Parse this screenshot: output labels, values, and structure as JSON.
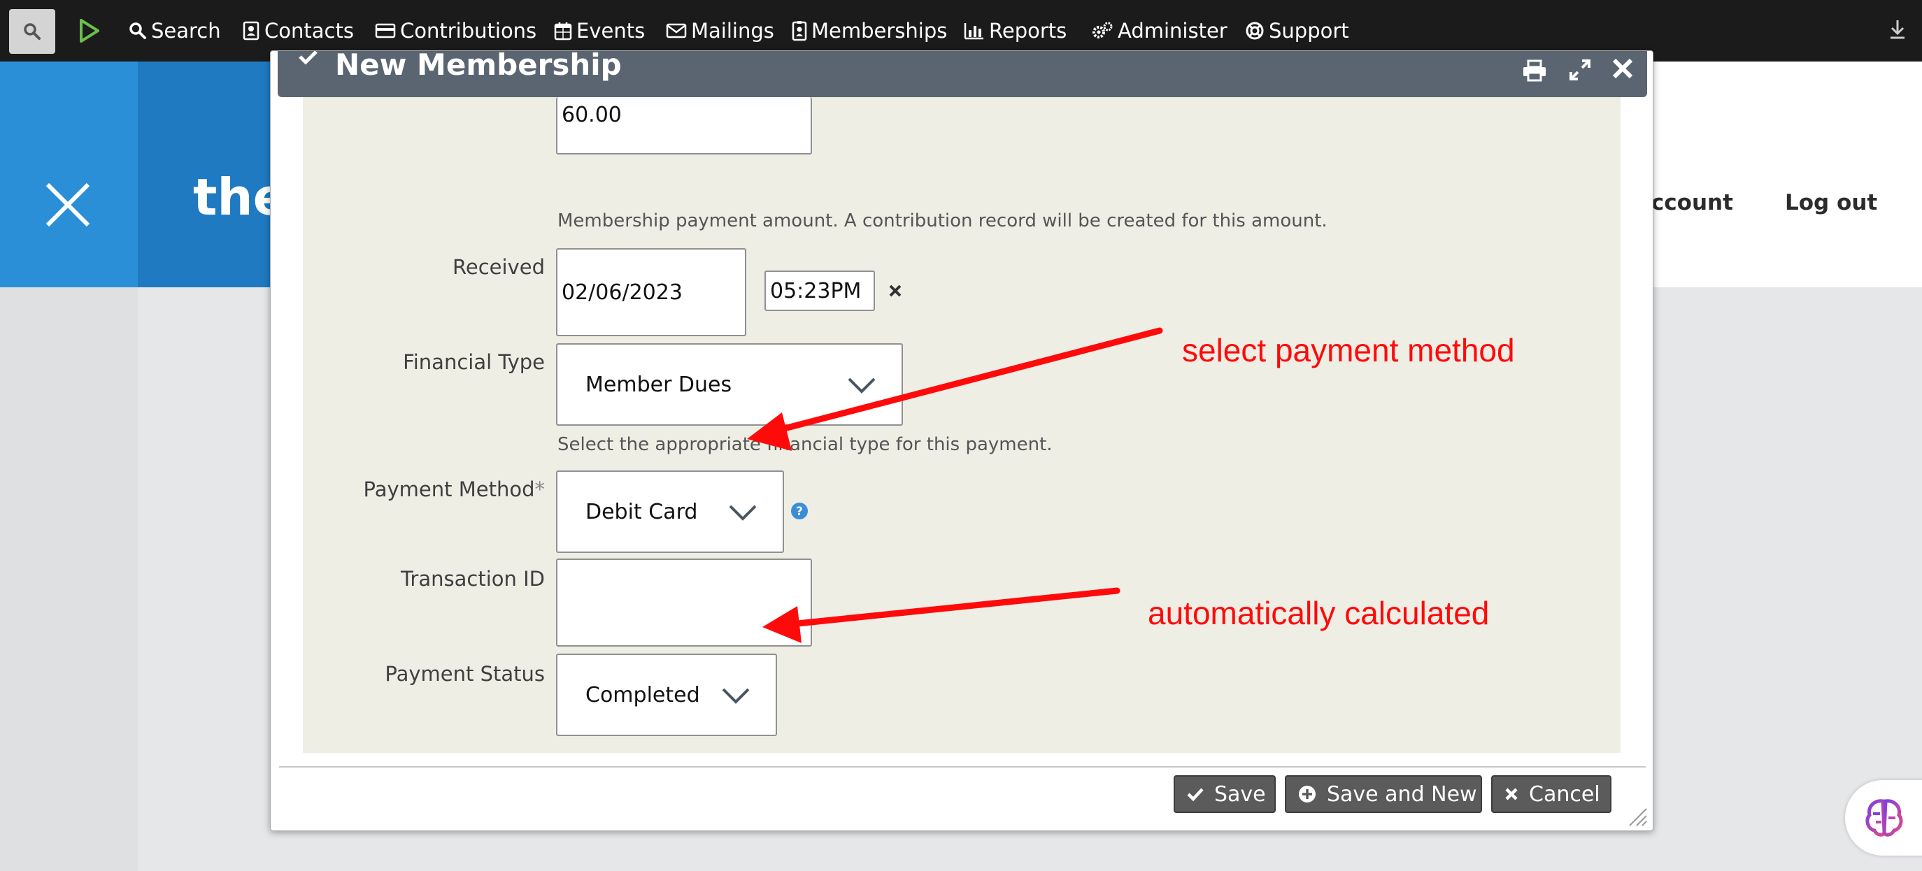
{
  "menubar": {
    "items": [
      {
        "label": "Search",
        "icon": "search-icon"
      },
      {
        "label": "Contacts",
        "icon": "contact-card-icon"
      },
      {
        "label": "Contributions",
        "icon": "credit-card-icon"
      },
      {
        "label": "Events",
        "icon": "calendar-icon"
      },
      {
        "label": "Mailings",
        "icon": "envelope-icon"
      },
      {
        "label": "Memberships",
        "icon": "id-badge-icon"
      },
      {
        "label": "Reports",
        "icon": "bar-chart-icon"
      },
      {
        "label": "Administer",
        "icon": "gears-icon"
      },
      {
        "label": "Support",
        "icon": "life-ring-icon"
      }
    ]
  },
  "site": {
    "title_fragment": "the",
    "account_link": "account",
    "logout_link": "Log out"
  },
  "dialog": {
    "title": "New Membership",
    "amount": {
      "value": "60.00",
      "help": "Membership payment amount. A contribution record will be created for this amount."
    },
    "received": {
      "label": "Received",
      "date": "02/06/2023",
      "time": "05:23PM"
    },
    "financial_type": {
      "label": "Financial Type",
      "value": "Member Dues",
      "help": "Select the appropriate financial type for this payment."
    },
    "payment_method": {
      "label": "Payment Method",
      "required_mark": "*",
      "value": "Debit Card"
    },
    "transaction_id": {
      "label": "Transaction ID",
      "value": ""
    },
    "payment_status": {
      "label": "Payment Status",
      "value": "Completed"
    },
    "buttons": {
      "save": "Save",
      "save_new": "Save and New",
      "cancel": "Cancel"
    }
  },
  "annotations": {
    "payment_method": "select payment method",
    "payment_status": "automatically calculated",
    "color": "#ff0a0a"
  }
}
